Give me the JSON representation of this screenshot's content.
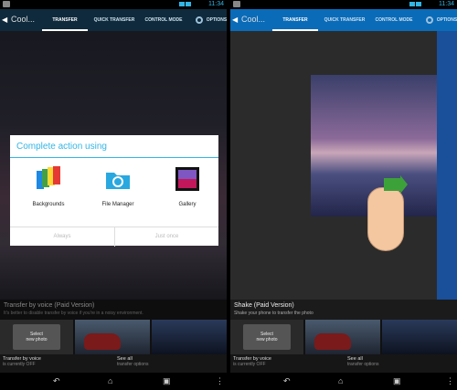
{
  "colors": {
    "accent": "#33b5e5",
    "actionbar_left": "#0f2a3c",
    "actionbar_right": "#0a6bb8"
  },
  "status": {
    "time": "11:34"
  },
  "app_title": "Cool...",
  "tabs": [
    "TRANSFER",
    "QUICK TRANSFER",
    "CONTROL MODE",
    "OPTIONS"
  ],
  "dialog": {
    "title": "Complete action using",
    "apps": [
      {
        "label": "Backgrounds",
        "icon": "backgrounds-icon"
      },
      {
        "label": "File Manager",
        "icon": "folder-icon"
      },
      {
        "label": "Gallery",
        "icon": "gallery-icon"
      }
    ],
    "always": "Always",
    "just_once": "Just once"
  },
  "left": {
    "section_title": "Transfer by voice (Paid Version)",
    "section_sub": "It's better to disable transfer by voice if you're in a noisy environment."
  },
  "right": {
    "section_title": "Shake (Paid Version)",
    "section_sub": "Shake your phone to transfer the photo"
  },
  "select_photo": "Select\nnew photo",
  "settings": {
    "voice_title": "Transfer by voice",
    "voice_sub": "is currently OFF",
    "see_title": "See all",
    "see_sub": "transfer options"
  }
}
